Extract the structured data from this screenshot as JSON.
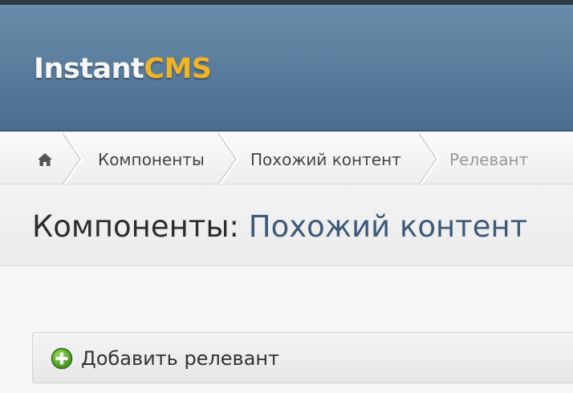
{
  "header": {
    "logo_part1": "Instant",
    "logo_part2": "CMS"
  },
  "breadcrumb": {
    "home_icon": "home-icon",
    "items": [
      {
        "label": "Компоненты"
      },
      {
        "label": "Похожий контент"
      },
      {
        "label": "Релевант"
      }
    ]
  },
  "page": {
    "title_main": "Компоненты:",
    "title_sub": "Похожий контент"
  },
  "toolbar": {
    "add_icon": "plus-circle-icon",
    "add_label": "Добавить релевант"
  },
  "colors": {
    "header_bg": "#5a7c9c",
    "logo_white": "#f7f7f7",
    "logo_accent": "#f0b323",
    "title_sub": "#3d5a7a",
    "add_icon_green": "#5aa82a"
  }
}
